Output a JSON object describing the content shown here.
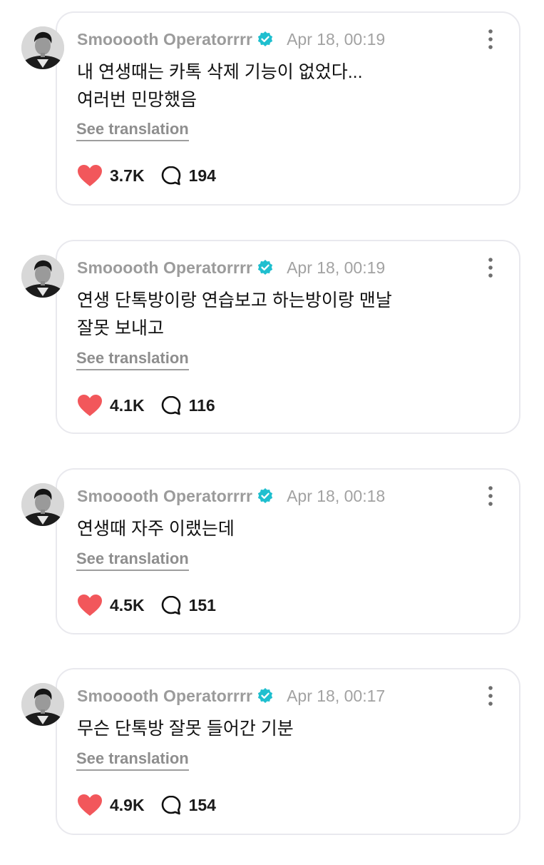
{
  "colors": {
    "verified_badge": "#1fbfcf",
    "heart": "#f2575b",
    "username": "#9b9b9b",
    "card_border": "#e9e9ee"
  },
  "icons": {
    "like": "heart-icon",
    "reply": "speech-bubble-icon",
    "more": "more-vertical-icon",
    "verified": "verified-badge-icon"
  },
  "posts": [
    {
      "username": "Smooooth Operatorrrr",
      "timestamp": "Apr 18, 00:19",
      "lines": [
        "내 연생때는 카톡 삭제 기능이 없었다...",
        "여러번 민망했음"
      ],
      "translation_label": "See translation",
      "likes": "3.7K",
      "replies": "194"
    },
    {
      "username": "Smooooth Operatorrrr",
      "timestamp": "Apr 18, 00:19",
      "lines": [
        "연생 단톡방이랑 연습보고 하는방이랑 맨날",
        "잘못 보내고"
      ],
      "translation_label": "See translation",
      "likes": "4.1K",
      "replies": "116"
    },
    {
      "username": "Smooooth Operatorrrr",
      "timestamp": "Apr 18, 00:18",
      "lines": [
        "연생때 자주 이랬는데"
      ],
      "translation_label": "See translation",
      "likes": "4.5K",
      "replies": "151"
    },
    {
      "username": "Smooooth Operatorrrr",
      "timestamp": "Apr 18, 00:17",
      "lines": [
        "무슨 단톡방 잘못 들어간 기분"
      ],
      "translation_label": "See translation",
      "likes": "4.9K",
      "replies": "154"
    }
  ]
}
